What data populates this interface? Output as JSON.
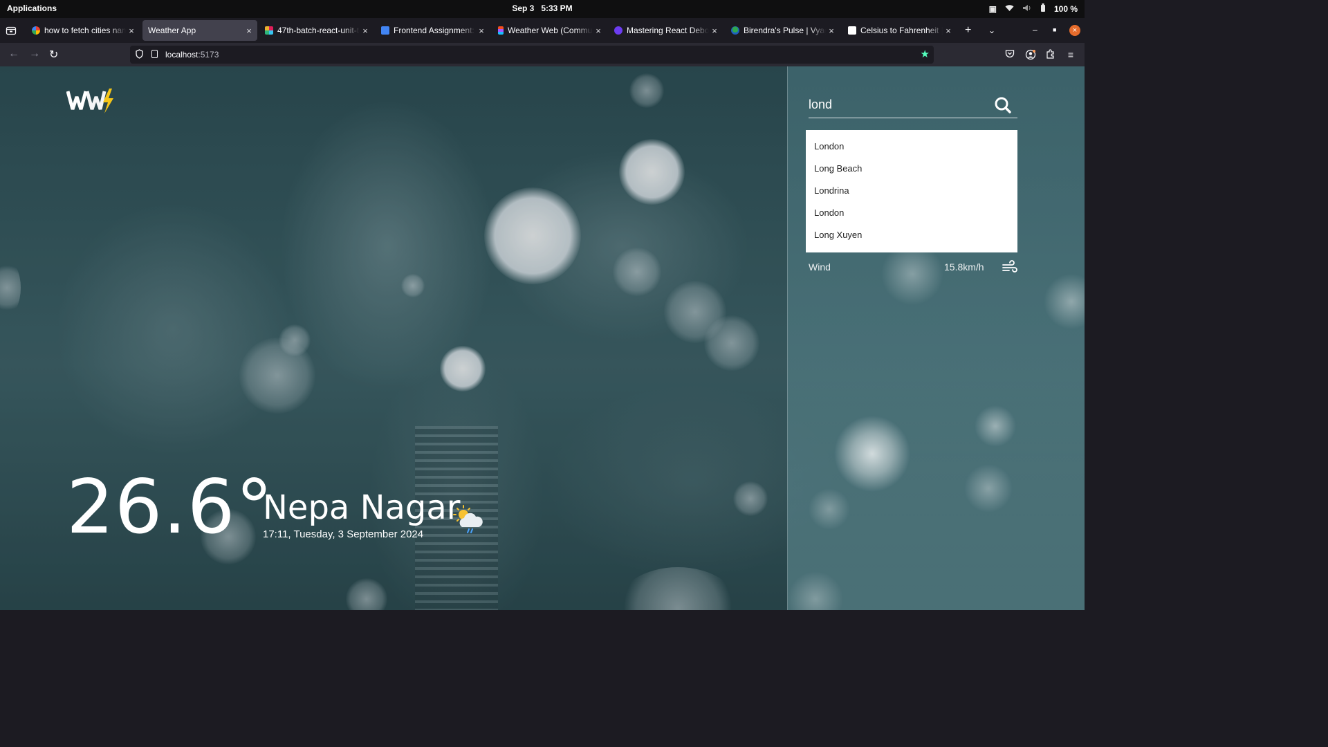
{
  "os": {
    "apps_label": "Applications",
    "date": "Sep 3",
    "time": "5:33 PM",
    "battery": "100 %"
  },
  "tabs": [
    {
      "title": "how to fetch cities name",
      "favicon_color": "#ffffff",
      "active": false
    },
    {
      "title": "Weather App",
      "favicon_color": "",
      "active": true
    },
    {
      "title": "47th-batch-react-unit-te",
      "favicon_color": "#e01e5a",
      "active": false
    },
    {
      "title": "Frontend Assignment: We",
      "favicon_color": "#4285f4",
      "active": false
    },
    {
      "title": "Weather Web (Communit",
      "favicon_color": "#f24e1e",
      "active": false
    },
    {
      "title": "Mastering React Debounc",
      "favicon_color": "#6c3cf0",
      "active": false
    },
    {
      "title": "Birendra's Pulse | Vyagu",
      "favicon_color": "#2fa84f",
      "active": false
    },
    {
      "title": "Celsius to Fahrenheit | °",
      "favicon_color": "#ffffff",
      "active": false
    }
  ],
  "url": {
    "host": "localhost",
    "port": ":5173"
  },
  "app": {
    "temperature": "26.6°",
    "city": "Nepa Nagar",
    "datetime": "17:11, Tuesday, 3 September 2024",
    "weather_icon": "sun-cloud-rain-icon"
  },
  "search": {
    "query": "lond",
    "suggestions": [
      "London",
      "Long Beach",
      "Londrina",
      "London",
      "Long Xuyen"
    ]
  },
  "details": {
    "wind_label": "Wind",
    "wind_value": "15.8km/h"
  },
  "colors": {
    "accent_yellow": "#f5c518",
    "bookmark_star": "#54ffbd",
    "window_close": "#e66c2c"
  }
}
